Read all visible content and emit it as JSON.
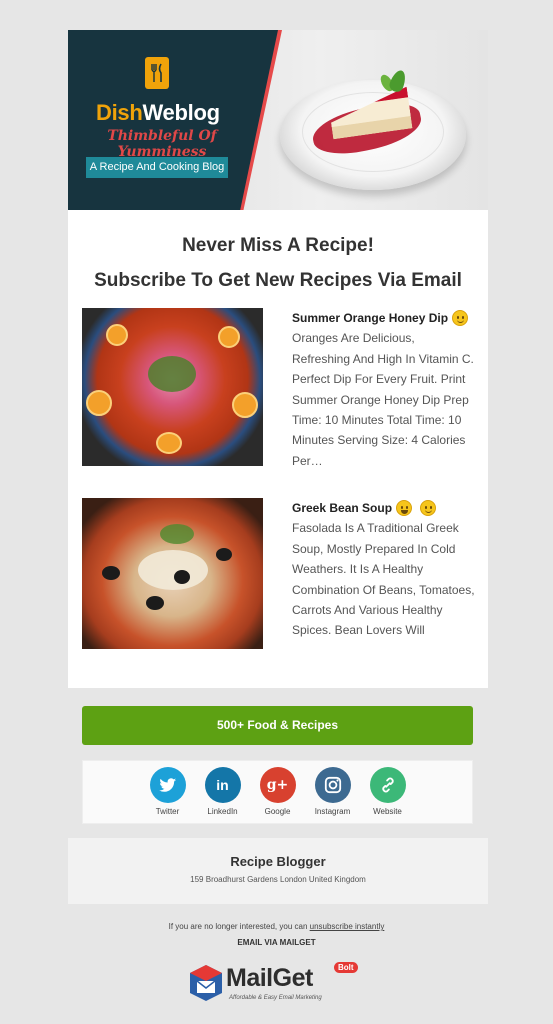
{
  "header": {
    "brand_part1": "Dish",
    "brand_part2": "Weblog",
    "tagline": "Thimbleful Of Yumminess",
    "subtag": "A Recipe And Cooking Blog"
  },
  "headline": {
    "line1": "Never Miss A Recipe!",
    "line2": "Subscribe To Get New Recipes Via Email"
  },
  "recipes": [
    {
      "title": "Summer Orange Honey Dip",
      "emoji": "smile-emoji",
      "description": "Oranges Are Delicious, Refreshing And High In Vitamin C. Perfect Dip For Every Fruit. Print Summer Orange Honey Dip Prep Time: 10 Minutes Total Time: 10 Minutes Serving Size: 4 Calories Per…"
    },
    {
      "title": "Greek Bean Soup",
      "emoji": "grin-emoji",
      "description": "Fasolada Is A Traditional Greek Soup, Mostly Prepared In Cold Weathers. It Is A Healthy Combination Of Beans, Tomatoes, Carrots And Various Healthy Spices. Bean Lovers Will"
    }
  ],
  "cta": {
    "label": "500+ Food & Recipes"
  },
  "social": [
    {
      "label": "Twitter",
      "icon": "twitter-icon",
      "color": "#1da1d8",
      "glyph": "t"
    },
    {
      "label": "LinkedIn",
      "icon": "linkedin-icon",
      "color": "#1476a8",
      "glyph": "in"
    },
    {
      "label": "Google",
      "icon": "google-plus-icon",
      "color": "#d8412f",
      "glyph": "g+"
    },
    {
      "label": "Instagram",
      "icon": "instagram-icon",
      "color": "#3d6a91",
      "glyph": "◎"
    },
    {
      "label": "Website",
      "icon": "link-icon",
      "color": "#3cb878",
      "glyph": "∞"
    }
  ],
  "footer": {
    "name": "Recipe Blogger",
    "address": "159 Broadhurst Gardens London United Kingdom"
  },
  "unsubscribe": {
    "prefix": "If you are no longer interested, you can ",
    "link": "unsubscribe instantly"
  },
  "email_via": "EMAIL VIA MAILGET",
  "mailget": {
    "word": "MailGet",
    "bolt": "Bolt",
    "tag": "Affordable & Easy Email Marketing"
  },
  "colors": {
    "banner_dark": "#17343f",
    "brand_orange": "#f0a30a",
    "tagline_red": "#e04848",
    "cta_green": "#5da113"
  }
}
